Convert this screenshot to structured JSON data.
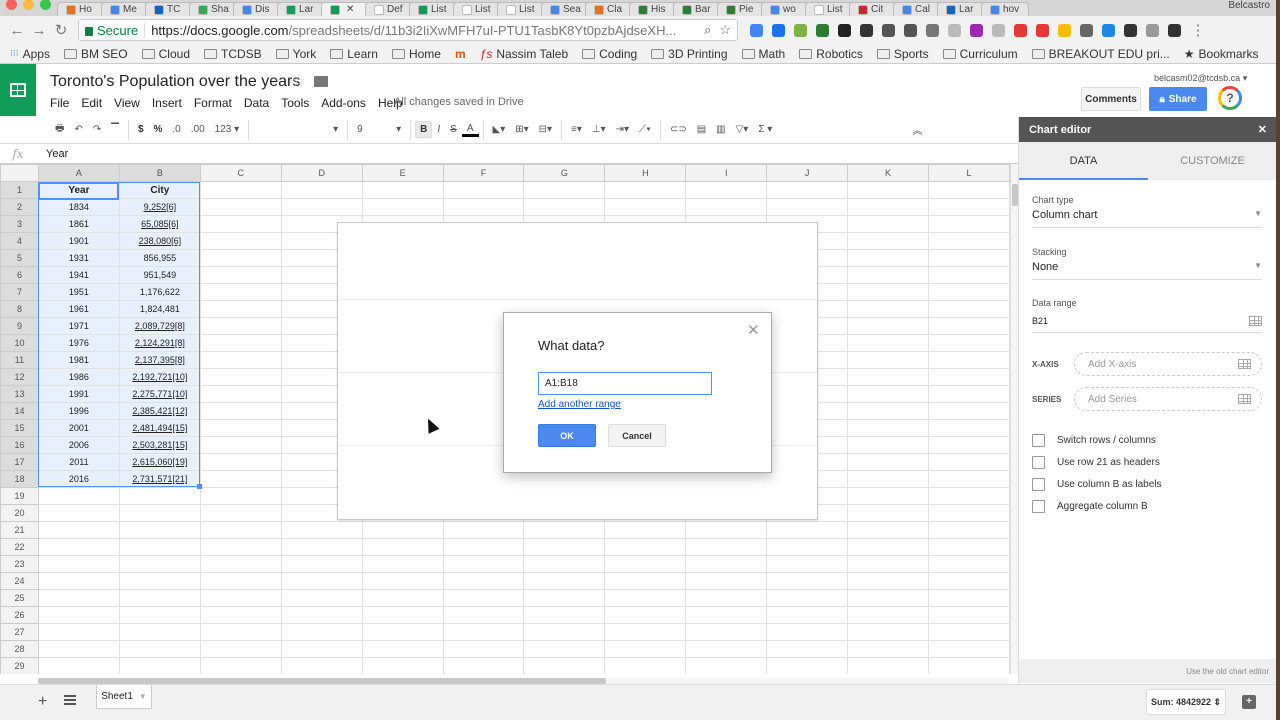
{
  "browser": {
    "tabs": [
      {
        "label": "Ho",
        "color": "#e8711c"
      },
      {
        "label": "Me",
        "color": "#4285f4"
      },
      {
        "label": "TC",
        "color": "#1565c0"
      },
      {
        "label": "Sha",
        "color": "#34a853"
      },
      {
        "label": "Dis",
        "color": "#4285f4"
      },
      {
        "label": "Lar",
        "color": "#0f9d58"
      },
      {
        "label": "",
        "color": "#0f9d58",
        "active": true
      },
      {
        "label": "Def",
        "color": "#ffffff"
      },
      {
        "label": "List",
        "color": "#0f9d58"
      },
      {
        "label": "List",
        "color": "#ffffff"
      },
      {
        "label": "List",
        "color": "#ffffff"
      },
      {
        "label": "Sea",
        "color": "#4285f4"
      },
      {
        "label": "Cla",
        "color": "#e8711c"
      },
      {
        "label": "His",
        "color": "#2e7d32"
      },
      {
        "label": "Bar",
        "color": "#2e7d32"
      },
      {
        "label": "Pie",
        "color": "#2e7d32"
      },
      {
        "label": "wo",
        "color": "#4285f4"
      },
      {
        "label": "List",
        "color": "#ffffff"
      },
      {
        "label": "Cit",
        "color": "#c62828"
      },
      {
        "label": "Cal",
        "color": "#4285f4"
      },
      {
        "label": "Lar",
        "color": "#1565c0"
      },
      {
        "label": "hov",
        "color": "#4285f4"
      }
    ],
    "profile_name": "Belcastro",
    "secure_label": "Secure",
    "url_host": "https://docs.google.com",
    "url_path": "/spreadsheets/d/11b3i2IiXwMFH7uI-PTU1TasbK8Yt0pzbAjdseXH...",
    "extension_colors": [
      "#4285f4",
      "#1a73e8",
      "#7cb342",
      "#2e7d32",
      "#222222",
      "#333333",
      "#555555",
      "#555555",
      "#777777",
      "#bbbbbb",
      "#9c27b0",
      "#bbbbbb",
      "#e53935",
      "#e53935",
      "#fbbc05",
      "#666666",
      "#1e88e5",
      "#333333",
      "#999999",
      "#333333"
    ],
    "bookmarks": [
      {
        "label": "Apps",
        "icon": "apps-grid"
      },
      {
        "label": "BM SEO",
        "icon": "folder"
      },
      {
        "label": "Cloud",
        "icon": "folder"
      },
      {
        "label": "TCDSB",
        "icon": "folder"
      },
      {
        "label": "York",
        "icon": "folder"
      },
      {
        "label": "Learn",
        "icon": "folder"
      },
      {
        "label": "Home",
        "icon": "folder"
      },
      {
        "label": "",
        "icon": "mortarboard"
      },
      {
        "label": "Nassim Taleb",
        "icon": "fs-logo"
      },
      {
        "label": "Coding",
        "icon": "folder"
      },
      {
        "label": "3D Printing",
        "icon": "folder"
      },
      {
        "label": "Math",
        "icon": "folder"
      },
      {
        "label": "Robotics",
        "icon": "folder"
      },
      {
        "label": "Sports",
        "icon": "folder"
      },
      {
        "label": "Curriculum",
        "icon": "folder"
      },
      {
        "label": "BREAKOUT EDU pri...",
        "icon": "folder"
      },
      {
        "label": "Bookmarks",
        "icon": "star"
      }
    ]
  },
  "doc": {
    "title": "Toronto's Population over the years",
    "menu": [
      "File",
      "Edit",
      "View",
      "Insert",
      "Format",
      "Data",
      "Tools",
      "Add-ons",
      "Help"
    ],
    "save_status": "All changes saved in Drive",
    "account": "belcasm02@tcdsb.ca",
    "comments_label": "Comments",
    "share_label": "Share",
    "help_label": "?"
  },
  "toolbar": {
    "currency": "$",
    "percent": "%",
    "dec_less": ".0",
    "dec_more": ".00",
    "more_formats": "123",
    "font_name": "",
    "font_size": "9",
    "bold": "B",
    "italic": "I",
    "strike": "S",
    "text_color": "A",
    "sigma": "Σ"
  },
  "formula_bar": {
    "fx": "fx",
    "value": "Year"
  },
  "grid": {
    "columns": [
      "A",
      "B",
      "C",
      "D",
      "E",
      "F",
      "G",
      "H",
      "I",
      "J",
      "K",
      "L"
    ],
    "header_row": {
      "year": "Year",
      "city": "City"
    },
    "rows": [
      {
        "year": "1834",
        "city": "9,252[6]",
        "link": true
      },
      {
        "year": "1861",
        "city": "65,085[6]",
        "link": true
      },
      {
        "year": "1901",
        "city": "238,080[6]",
        "link": true
      },
      {
        "year": "1931",
        "city": "856,955",
        "link": false
      },
      {
        "year": "1941",
        "city": "951,549",
        "link": false
      },
      {
        "year": "1951",
        "city": "1,176,622",
        "link": false
      },
      {
        "year": "1961",
        "city": "1,824,481",
        "link": false
      },
      {
        "year": "1971",
        "city": "2,089,729[8]",
        "link": true
      },
      {
        "year": "1976",
        "city": "2,124,291[8]",
        "link": true
      },
      {
        "year": "1981",
        "city": "2,137,395[8]",
        "link": true
      },
      {
        "year": "1986",
        "city": "2,192,721[10]",
        "link": true
      },
      {
        "year": "1991",
        "city": "2,275,771[10]",
        "link": true
      },
      {
        "year": "1996",
        "city": "2,385,421[12]",
        "link": true
      },
      {
        "year": "2001",
        "city": "2,481,494[15]",
        "link": true
      },
      {
        "year": "2006",
        "city": "2,503,281[15]",
        "link": true
      },
      {
        "year": "2011",
        "city": "2,615,060[19]",
        "link": true
      },
      {
        "year": "2016",
        "city": "2,731,571[21]",
        "link": true
      }
    ],
    "total_rows": 29
  },
  "dialog": {
    "title": "What data?",
    "range_value": "A1:B18",
    "add_range_label": "Add another range",
    "ok_label": "OK",
    "cancel_label": "Cancel"
  },
  "chart_editor": {
    "title": "Chart editor",
    "tabs": [
      {
        "label": "DATA",
        "active": true
      },
      {
        "label": "CUSTOMIZE",
        "active": false
      }
    ],
    "chart_type_label": "Chart type",
    "chart_type_value": "Column chart",
    "stacking_label": "Stacking",
    "stacking_value": "None",
    "data_range_label": "Data range",
    "data_range_value": "B21",
    "x_axis_label": "X-AXIS",
    "x_axis_placeholder": "Add X-axis",
    "series_label": "SERIES",
    "series_placeholder": "Add Series",
    "checkboxes": [
      {
        "label": "Switch rows / columns",
        "checked": false
      },
      {
        "label": "Use row 21 as headers",
        "checked": false
      },
      {
        "label": "Use column B as labels",
        "checked": false
      },
      {
        "label": "Aggregate column B",
        "checked": false
      }
    ],
    "old_editor_label": "Use the old chart editor"
  },
  "bottom": {
    "sheet_name": "Sheet1",
    "sum_label": "Sum: 4842922"
  },
  "colors": {
    "sheets_green": "#0f9d58",
    "accent_blue": "#4a89ee",
    "selection_blue": "#4d90fe"
  }
}
